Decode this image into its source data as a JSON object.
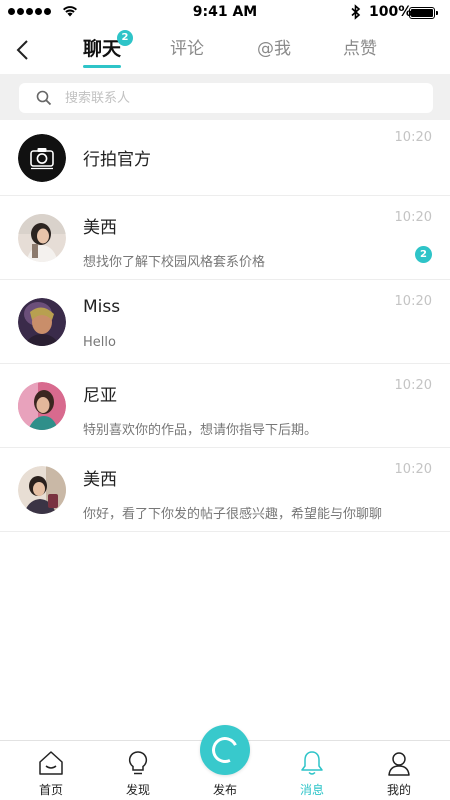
{
  "status_bar": {
    "time": "9:41 AM",
    "battery": "100%"
  },
  "header": {
    "tabs": [
      {
        "label": "聊天",
        "badge": "2",
        "active": true
      },
      {
        "label": "评论"
      },
      {
        "label": "@我"
      },
      {
        "label": "点赞"
      }
    ]
  },
  "search": {
    "placeholder": "搜索联系人"
  },
  "conversations": [
    {
      "name": "行拍官方",
      "preview": "",
      "time": "10:20",
      "avatar": "camera-logo"
    },
    {
      "name": "美西",
      "preview": "想找你了解下校园风格套系价格",
      "time": "10:20",
      "badge": "2",
      "avatar": "user-photo"
    },
    {
      "name": "Miss",
      "preview": "Hello",
      "time": "10:20",
      "avatar": "user-photo"
    },
    {
      "name": "尼亚",
      "preview": "特别喜欢你的作品，想请你指导下后期。",
      "time": "10:20",
      "avatar": "user-photo"
    },
    {
      "name": "美西",
      "preview": "你好，看了下你发的帖子很感兴趣，希望能与你聊聊",
      "time": "10:20",
      "avatar": "user-photo"
    }
  ],
  "tabbar": {
    "items": [
      {
        "label": "首页",
        "icon": "home-icon"
      },
      {
        "label": "发现",
        "icon": "lightbulb-icon"
      },
      {
        "label": "发布",
        "icon": "publish-icon"
      },
      {
        "label": "消息",
        "icon": "bell-icon",
        "active": true
      },
      {
        "label": "我的",
        "icon": "user-icon"
      }
    ]
  },
  "colors": {
    "accent": "#2ec4c8",
    "divider": "#ededed",
    "search_bg": "#f0f0f0"
  }
}
